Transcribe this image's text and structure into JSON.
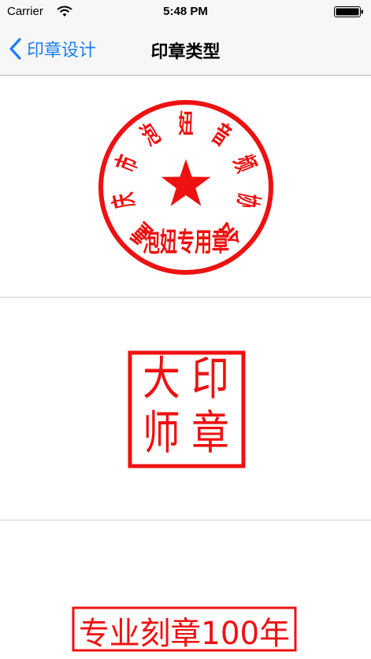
{
  "status_bar": {
    "carrier": "Carrier",
    "time": "5:48 PM"
  },
  "nav": {
    "back_label": "印章设计",
    "title": "印章类型"
  },
  "seals": [
    {
      "kind": "round",
      "arc_text": [
        "重",
        "庆",
        "市",
        "泡",
        "妞",
        "音",
        "频",
        "协",
        "会"
      ],
      "bottom_text": "泡妞专用章",
      "center_icon": "star-icon"
    },
    {
      "kind": "square",
      "chars": [
        "印",
        "章",
        "大",
        "师"
      ]
    },
    {
      "kind": "rectangle",
      "text": "专业刻章100年"
    }
  ],
  "colors": {
    "seal_red": "#ee1111",
    "ios_blue": "#1a7ef5",
    "bar_bg": "#f7f7f7"
  }
}
